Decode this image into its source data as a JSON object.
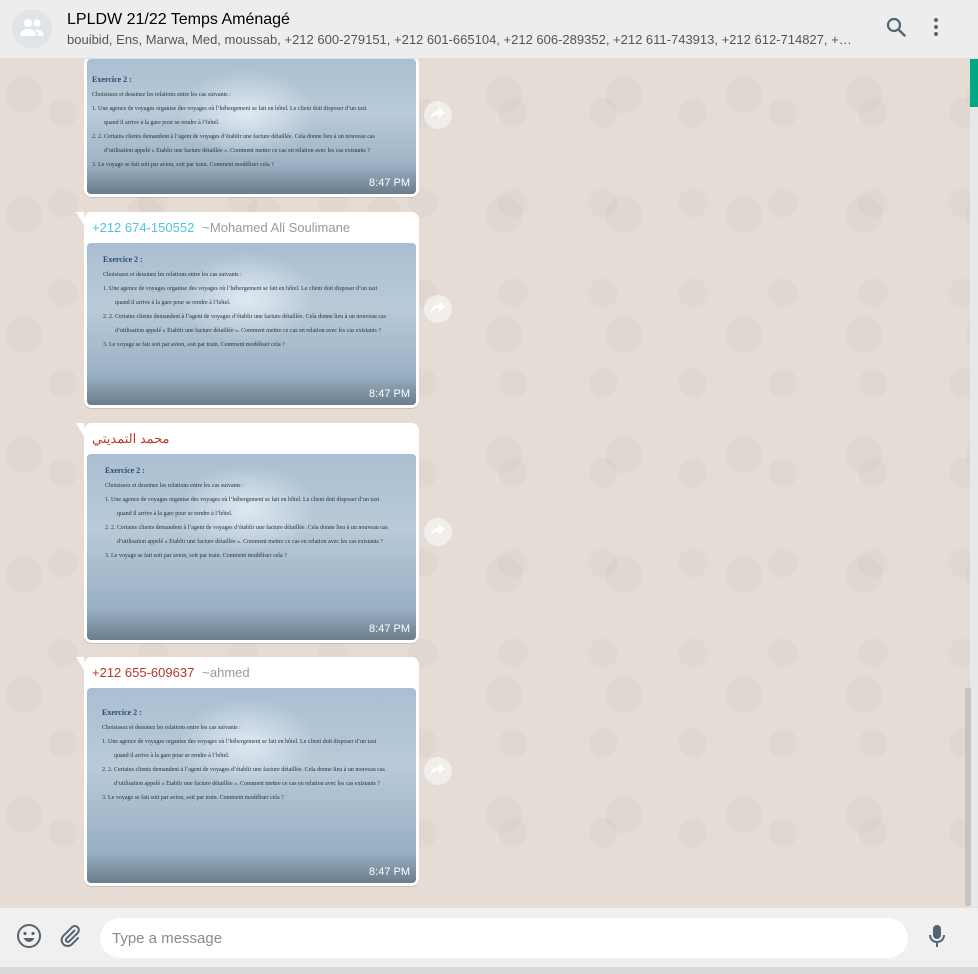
{
  "header": {
    "title": "LPLDW 21/22 Temps Aménagé",
    "participants": "bouibid, Ens, Marwa, Med, moussab, +212 600-279151, +212 601-665104, +212 606-289352, +212 611-743913, +212 612-714827, +…",
    "avatar_icon": "group-icon",
    "search_icon": "search-icon",
    "menu_icon": "menu-icon"
  },
  "colors": {
    "accent": "#00a884",
    "sender_blue": "#4fc3e0",
    "sender_red": "#c0392b",
    "sender_dark_red": "#b03a2e"
  },
  "document": {
    "exercise_title": "Exercice 2 :",
    "intro": "Choisissez et dessinez les relations entre les cas suivants :",
    "item1": "1.   Une agence de voyages organise des voyages où l’hébergement se fait en hôtel. Le client doit disposer d’un taxi",
    "item1b": "quand il arrive à la gare pour se rendre à l’hôtel.",
    "item2": "2.   2. Certains clients demandent à l’agent de voyages d’établir une facture détaillée. Cela donne lieu à un nouveau cas",
    "item2b": "d’utilisation appelé « Établir une facture détaillée ». Comment mettre ce cas en relation avec les cas existants ?",
    "item3": "3.   Le voyage se fait soit par avion, soit par train. Comment modéliser cela ?"
  },
  "messages": [
    {
      "sender_number": "",
      "sender_alias": "",
      "time": "8:47 PM"
    },
    {
      "sender_number": "+212 674-150552",
      "sender_alias": "~Mohamed Ali Soulimane",
      "time": "8:47 PM"
    },
    {
      "sender_number": "محمد التمديتي",
      "sender_alias": "",
      "time": "8:47 PM"
    },
    {
      "sender_number": "+212 655-609637",
      "sender_alias": "~ahmed",
      "time": "8:47 PM"
    }
  ],
  "forward_icon": "forward-icon",
  "composer": {
    "placeholder": "Type a message",
    "emoji_icon": "emoji-icon",
    "attach_icon": "attach-icon",
    "mic_icon": "mic-icon"
  }
}
